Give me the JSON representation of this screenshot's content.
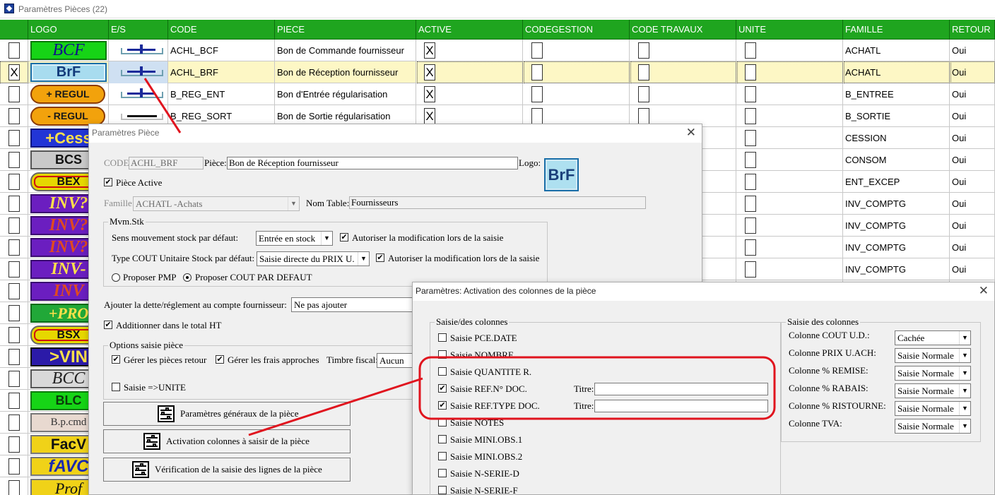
{
  "window": {
    "title": "Paramètres Pièces (22)"
  },
  "grid": {
    "columns": [
      "",
      "LOGO",
      "E/S",
      "CODE",
      "PIECE",
      "ACTIVE",
      "CODEGESTION",
      "CODE TRAVAUX",
      "UNITE",
      "FAMILLE",
      "RETOUR"
    ],
    "rows": [
      {
        "logo": "BCF",
        "code": "ACHL_BCF",
        "piece": "Bon de Commande fournisseur",
        "famille": "ACHATL",
        "retour": "Oui"
      },
      {
        "logo": "BrF",
        "code": "ACHL_BRF",
        "piece": "Bon de Réception fournisseur",
        "famille": "ACHATL",
        "retour": "Oui"
      },
      {
        "logo": "+ REGUL",
        "code": "B_REG_ENT",
        "piece": "Bon d'Entrée régularisation",
        "famille": "B_ENTREE",
        "retour": "Oui"
      },
      {
        "logo": "- REGUL",
        "code": "B_REG_SORT",
        "piece": "Bon de Sortie régularisation",
        "famille": "B_SORTIE",
        "retour": "Oui"
      },
      {
        "logo": "+Cess",
        "famille": "CESSION",
        "retour": "Oui"
      },
      {
        "logo": "BCS",
        "famille": "CONSOM",
        "retour": "Oui"
      },
      {
        "logo": "BEX",
        "famille": "ENT_EXCEP",
        "retour": "Oui"
      },
      {
        "logo": "INV?",
        "famille": "INV_COMPTG",
        "retour": "Oui"
      },
      {
        "logo": "INV?",
        "famille": "INV_COMPTG",
        "retour": "Oui"
      },
      {
        "logo": "INV?",
        "famille": "INV_COMPTG",
        "retour": "Oui"
      },
      {
        "logo": "INV-",
        "famille": "INV_COMPTG",
        "retour": "Oui"
      },
      {
        "logo": "INV",
        "famille": "",
        "retour": ""
      },
      {
        "logo": "+PRO",
        "famille": "",
        "retour": ""
      },
      {
        "logo": "BSX",
        "famille": "",
        "retour": ""
      },
      {
        "logo": ">VIN",
        "famille": "",
        "retour": ""
      },
      {
        "logo": "BCC",
        "famille": "",
        "retour": ""
      },
      {
        "logo": "BLC",
        "famille": "",
        "retour": ""
      },
      {
        "logo": "B.p.cmd",
        "famille": "",
        "retour": ""
      },
      {
        "logo": "FacV",
        "famille": "",
        "retour": ""
      },
      {
        "logo": "fAVC",
        "famille": "",
        "retour": ""
      },
      {
        "logo": "Prof",
        "famille": "",
        "retour": ""
      }
    ],
    "check_mark": "X"
  },
  "piece_dialog": {
    "title": "Paramètres Pièce",
    "code_label": "CODE:",
    "code_value": "ACHL_BRF",
    "piece_label": "Pièce:",
    "piece_value": "Bon de Réception fournisseur",
    "logo_label": "Logo:",
    "logo_text": "BrF",
    "piece_active_label": "Pièce Active",
    "famille_label": "Famille:",
    "famille_value": "ACHATL    -Achats",
    "nom_table_label": "Nom Table:",
    "nom_table_value": "Fournisseurs",
    "mvm_group": "Mvm.Stk",
    "sens_label": "Sens mouvement stock par défaut:",
    "sens_value": "Entrée en stock",
    "autoriser1": "Autoriser la modification lors de la saisie",
    "type_cout_label": "Type COUT Unitaire Stock par défaut:",
    "type_cout_value": "Saisie directe du PRIX U.",
    "autoriser2": "Autoriser la modification lors de la saisie",
    "proposer_pmp": "Proposer PMP",
    "proposer_cout": "Proposer COUT PAR DEFAUT",
    "ajouter_label": "Ajouter la dette/réglement au compte fournisseur:",
    "ajouter_value": "Ne pas ajouter",
    "additionner_label": "Additionner dans le total HT",
    "options_group": "Options saisie pièce",
    "gerer_retour": "Gérer les pièces retour",
    "gerer_frais": "Gérer les frais approches",
    "timbre_label": "Timbre fiscal:",
    "timbre_value": "Aucun",
    "saisie_unite": "Saisie =>UNITE",
    "btn_params": "Paramètres généraux de la pièce",
    "btn_activation": "Activation colonnes à saisir de la pièce",
    "btn_verif": "Vérification  de la saisie des lignes de la pièce"
  },
  "columns_dialog": {
    "title": "Paramètres: Activation des colonnes de la pièce",
    "left_group": "Saisie/des colonnes",
    "items": [
      {
        "label": "Saisie PCE.DATE",
        "checked": false
      },
      {
        "label": "Saisie NOMBRE",
        "checked": false
      },
      {
        "label": "Saisie QUANTITE R.",
        "checked": false
      },
      {
        "label": "Saisie REF.N° DOC.",
        "checked": true,
        "titre": "Titre:"
      },
      {
        "label": "Saisie REF.TYPE DOC.",
        "checked": true,
        "titre": "Titre:"
      },
      {
        "label": "Saisie NOTES",
        "checked": false
      },
      {
        "label": "Saisie MINI.OBS.1",
        "checked": false
      },
      {
        "label": "Saisie MINI.OBS.2",
        "checked": false
      },
      {
        "label": "Saisie N-SERIE-D",
        "checked": false
      },
      {
        "label": "Saisie N-SERIE-F",
        "checked": false
      }
    ],
    "right_group": "Saisie des colonnes",
    "right_items": [
      {
        "label": "Colonne COUT U.D.:",
        "value": "Cachée"
      },
      {
        "label": "Colonne PRIX U.ACH:",
        "value": "Saisie Normale"
      },
      {
        "label": "Colonne % REMISE:",
        "value": "Saisie Normale"
      },
      {
        "label": "Colonne % RABAIS:",
        "value": "Saisie Normale"
      },
      {
        "label": "Colonne % RISTOURNE:",
        "value": "Saisie Normale"
      },
      {
        "label": "Colonne TVA:",
        "value": "Saisie Normale"
      }
    ]
  },
  "colors": {
    "header_green": "#1fa51f",
    "selected_row": "#fdf7c5",
    "annotation_red": "#e0141e"
  }
}
